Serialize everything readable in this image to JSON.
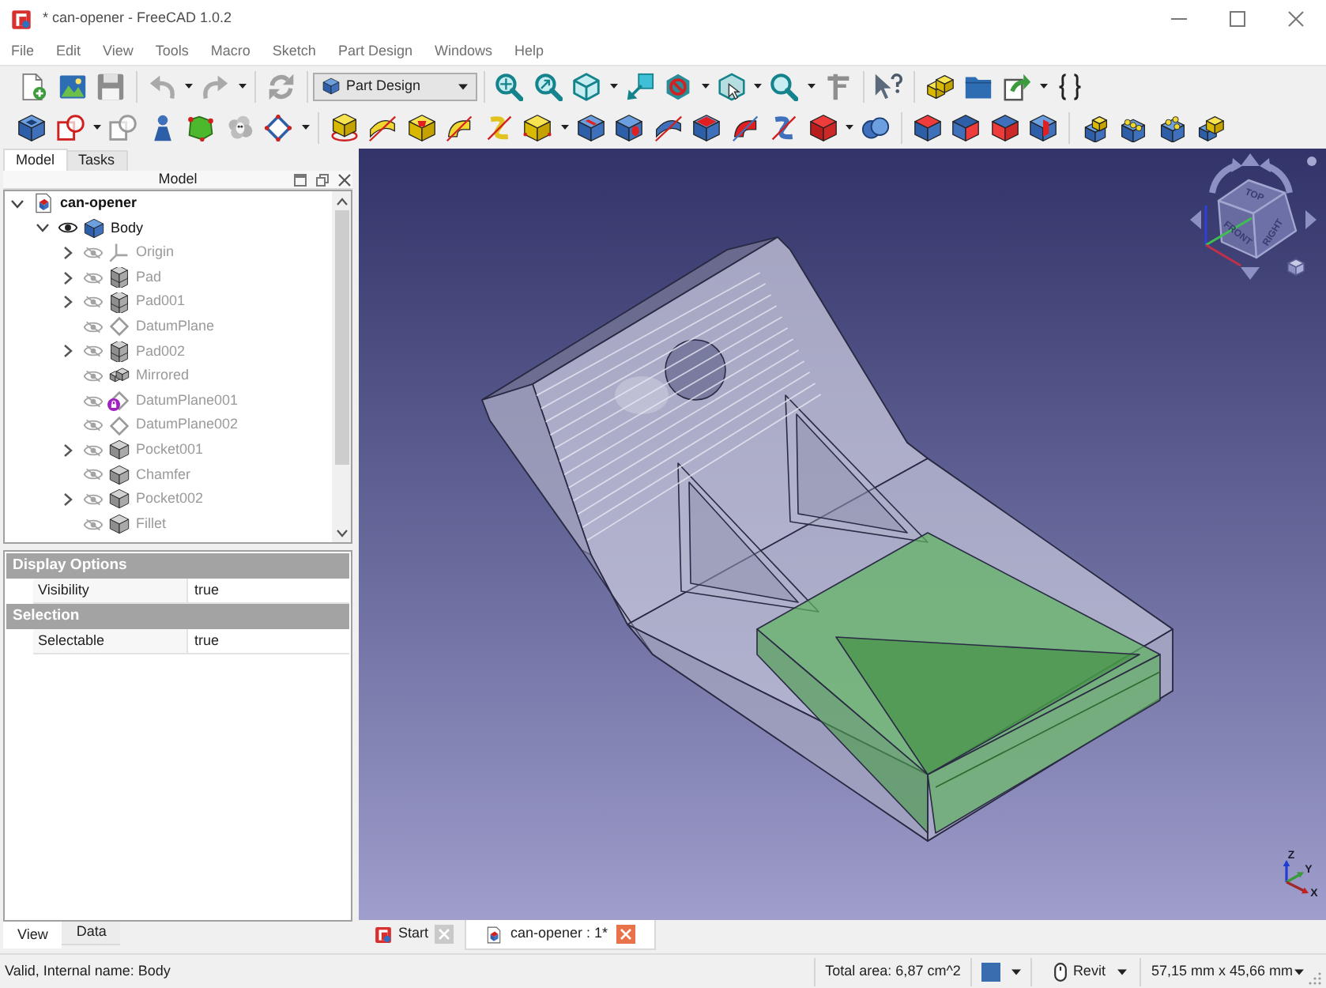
{
  "window": {
    "title": "* can-opener - FreeCAD 1.0.2"
  },
  "menu_bar": [
    "File",
    "Edit",
    "View",
    "Tools",
    "Macro",
    "Sketch",
    "Part Design",
    "Windows",
    "Help"
  ],
  "toolbar": {
    "workbench": "Part Design"
  },
  "combo_view": {
    "tabs": [
      {
        "label": "Model",
        "selected": true
      },
      {
        "label": "Tasks",
        "selected": false
      }
    ],
    "title": "Model",
    "tree": [
      {
        "label": "can-opener",
        "kind": "document",
        "expanded": true,
        "children": [
          {
            "label": "Body",
            "kind": "body",
            "expanded": true,
            "visible": true,
            "children": [
              {
                "label": "Origin",
                "kind": "origin",
                "expanded": false,
                "visible": false,
                "flagged": false
              },
              {
                "label": "Pad",
                "kind": "pad",
                "expanded": false,
                "visible": false,
                "flagged": false
              },
              {
                "label": "Pad001",
                "kind": "pad",
                "expanded": false,
                "visible": false,
                "flagged": false
              },
              {
                "label": "DatumPlane",
                "kind": "datum-plane",
                "visible": false,
                "flagged": false
              },
              {
                "label": "Pad002",
                "kind": "pad",
                "expanded": false,
                "visible": false,
                "flagged": false
              },
              {
                "label": "Mirrored",
                "kind": "mirrored",
                "visible": false,
                "flagged": false
              },
              {
                "label": "DatumPlane001",
                "kind": "datum-plane",
                "visible": false,
                "flagged": true
              },
              {
                "label": "DatumPlane002",
                "kind": "datum-plane",
                "visible": false,
                "flagged": false
              },
              {
                "label": "Pocket001",
                "kind": "pocket",
                "expanded": false,
                "visible": false,
                "flagged": false
              },
              {
                "label": "Chamfer",
                "kind": "chamfer",
                "visible": false,
                "flagged": false
              },
              {
                "label": "Pocket002",
                "kind": "pocket",
                "expanded": false,
                "visible": false,
                "flagged": false
              },
              {
                "label": "Fillet",
                "kind": "fillet",
                "visible": false,
                "flagged": false
              }
            ]
          }
        ]
      }
    ]
  },
  "property_view": {
    "groups": [
      {
        "name": "Display Options",
        "rows": [
          {
            "property": "Visibility",
            "value": "true"
          }
        ]
      },
      {
        "name": "Selection",
        "rows": [
          {
            "property": "Selectable",
            "value": "true"
          }
        ]
      }
    ],
    "tabs": [
      {
        "label": "View",
        "selected": true
      },
      {
        "label": "Data",
        "selected": false
      }
    ]
  },
  "viewport": {
    "navigation_cube": {
      "faces": [
        "TOP",
        "FRONT",
        "RIGHT"
      ]
    },
    "axis_labels": [
      "Z",
      "Y",
      "X"
    ]
  },
  "document_tabs": [
    {
      "label": "Start",
      "kind": "start",
      "selected": false
    },
    {
      "label": "can-opener : 1*",
      "kind": "document",
      "selected": true
    }
  ],
  "status_bar": {
    "message": "Valid, Internal name: Body",
    "total_area": "Total area: 6,87 cm^2",
    "navigation_style": "Revit",
    "dimensions": "57,15 mm x 45,66 mm"
  }
}
